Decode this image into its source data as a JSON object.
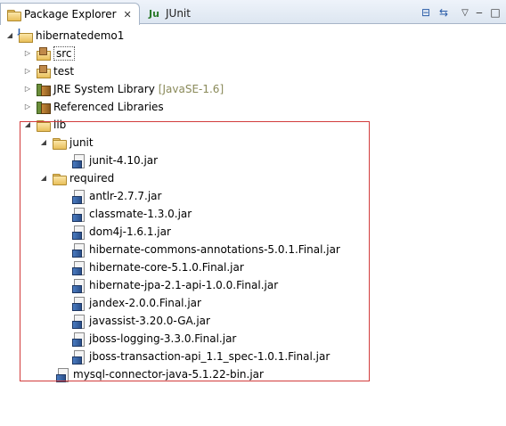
{
  "tabs": {
    "package_explorer": "Package Explorer",
    "close_glyph": "✕",
    "junit": "JUnit"
  },
  "toolbar": {
    "collapse_glyph": "⊟",
    "link_glyph": "⇆",
    "menu_glyph": "▽",
    "minimize_glyph": "‒",
    "maximize_glyph": "□"
  },
  "tree": {
    "project": "hibernatedemo1",
    "src": "src",
    "test": "test",
    "jre": "JRE System Library",
    "jre_version": "[JavaSE-1.6]",
    "referenced": "Referenced Libraries",
    "lib": "lib",
    "junit_folder": "junit",
    "junit_jar": "junit-4.10.jar",
    "required_folder": "required",
    "required_jars": [
      "antlr-2.7.7.jar",
      "classmate-1.3.0.jar",
      "dom4j-1.6.1.jar",
      "hibernate-commons-annotations-5.0.1.Final.jar",
      "hibernate-core-5.1.0.Final.jar",
      "hibernate-jpa-2.1-api-1.0.0.Final.jar",
      "jandex-2.0.0.Final.jar",
      "javassist-3.20.0-GA.jar",
      "jboss-logging-3.3.0.Final.jar",
      "jboss-transaction-api_1.1_spec-1.0.1.Final.jar"
    ],
    "mysql_jar": "mysql-connector-java-5.1.22-bin.jar"
  },
  "icons": {
    "package_explorer_tab": "package-explorer-icon",
    "junit_tab": "junit-icon",
    "project": "java-project-icon",
    "source_folder": "source-folder-icon",
    "library": "library-icon",
    "folder": "folder-icon",
    "jar": "jar-icon"
  },
  "colors": {
    "highlight_border": "#d23c3c",
    "decoration_text": "#8a8a5a"
  }
}
